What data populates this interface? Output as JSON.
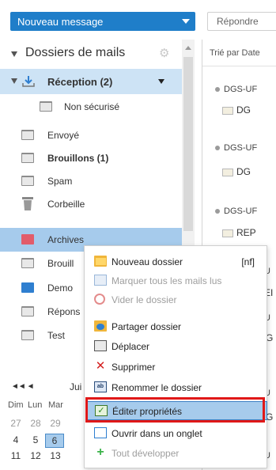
{
  "toolbar": {
    "new_message_label": "Nouveau message",
    "reply_label": "Répondre"
  },
  "sidebar": {
    "title": "Dossiers de mails",
    "folders": [
      {
        "label": "Réception (2)",
        "bold": true,
        "icon": "inbox-download-icon"
      },
      {
        "label": "Non sécurisé",
        "bold": false,
        "icon": "folder-icon"
      },
      {
        "label": "Envoyé",
        "bold": false,
        "icon": "sent-folder-icon"
      },
      {
        "label": "Brouillons (1)",
        "bold": true,
        "icon": "drafts-folder-icon"
      },
      {
        "label": "Spam",
        "bold": false,
        "icon": "spam-folder-icon"
      },
      {
        "label": "Corbeille",
        "bold": false,
        "icon": "trash-icon"
      },
      {
        "label": "Archives",
        "bold": false,
        "icon": "folder-red-icon"
      },
      {
        "label": "Brouill",
        "bold": false,
        "icon": "folder-icon"
      },
      {
        "label": "Demo",
        "bold": false,
        "icon": "folder-blue-icon"
      },
      {
        "label": "Répons",
        "bold": false,
        "icon": "folder-icon"
      },
      {
        "label": "Test",
        "bold": false,
        "icon": "folder-icon"
      }
    ]
  },
  "calendar": {
    "month_label": "Jui",
    "nav_label": "◄◄ ◄",
    "weekdays": [
      "Dim",
      "Lun",
      "Mar"
    ],
    "rows": [
      [
        "27",
        "28",
        "29"
      ],
      [
        "4",
        "5",
        "6"
      ],
      [
        "11",
        "12",
        "13"
      ]
    ],
    "selected": "6"
  },
  "mail_list": {
    "sort_label": "Trié par Date",
    "items": [
      {
        "sender": "DGS-UF",
        "subject": "DG"
      },
      {
        "sender": "DGS-UF",
        "subject": "DG"
      },
      {
        "sender": "DGS-UF",
        "subject": "REP"
      }
    ],
    "partial_letters": [
      "U",
      "EI",
      "U",
      "G",
      "U",
      "G",
      "U"
    ]
  },
  "context_menu": {
    "items": [
      {
        "label": "Nouveau dossier",
        "shortcut": "[nf]",
        "icon": "new-folder-icon",
        "disabled": false
      },
      {
        "label": "Marquer tous les mails lus",
        "shortcut": "",
        "icon": "mark-read-icon",
        "disabled": true
      },
      {
        "label": "Vider le dossier",
        "shortcut": "",
        "icon": "empty-folder-icon",
        "disabled": true
      },
      {
        "label": "Partager dossier",
        "shortcut": "",
        "icon": "share-folder-icon",
        "disabled": false
      },
      {
        "label": "Déplacer",
        "shortcut": "",
        "icon": "move-icon",
        "disabled": false
      },
      {
        "label": "Supprimer",
        "shortcut": "",
        "icon": "delete-icon",
        "disabled": false
      },
      {
        "label": "Renommer le dossier",
        "shortcut": "",
        "icon": "rename-icon",
        "disabled": false
      },
      {
        "label": "Éditer propriétés",
        "shortcut": "",
        "icon": "edit-properties-icon",
        "disabled": false,
        "highlighted": true
      },
      {
        "label": "Ouvrir dans un onglet",
        "shortcut": "",
        "icon": "open-tab-icon",
        "disabled": false
      },
      {
        "label": "Tout développer",
        "shortcut": "",
        "icon": "expand-all-icon",
        "disabled": true
      }
    ]
  },
  "colors": {
    "accent": "#1f7ec9",
    "selection": "#a6cbec",
    "highlight_outline": "#e01818"
  }
}
